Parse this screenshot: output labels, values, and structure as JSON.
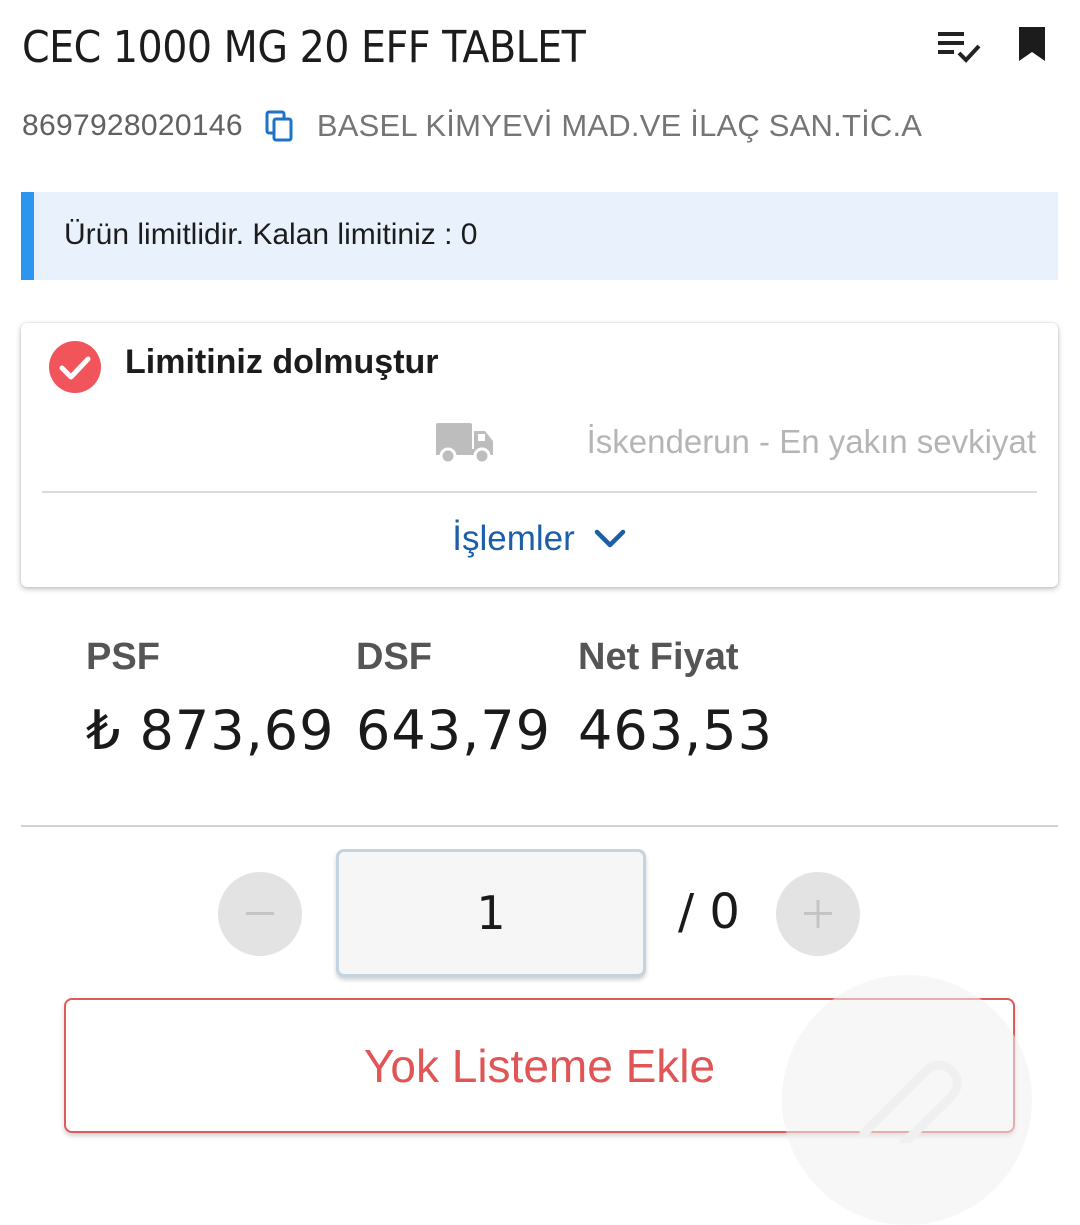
{
  "product": {
    "title": "CEC 1000 MG 20 EFF TABLET",
    "barcode": "8697928020146",
    "company": "BASEL KİMYEVİ MAD.VE İLAÇ SAN.TİC.A"
  },
  "icons": {
    "list": "playlist-check-icon",
    "bookmark": "bookmark-icon",
    "copy": "copy-icon",
    "status": "check-circle-icon",
    "truck": "truck-icon",
    "chevron": "chevron-down-icon",
    "minus": "minus-icon",
    "plus": "plus-icon"
  },
  "banner": {
    "text": "Ürün limitlidir. Kalan limitiniz : 0",
    "accent_color": "#2b95ef",
    "background_color": "#e9f2fc"
  },
  "status_card": {
    "status_text": "Limitiniz dolmuştur",
    "status_color": "#f2545b",
    "shipping_text": "İskenderun - En yakın sevkiyat",
    "actions_label": "İşlemler",
    "actions_color": "#1d5ea8"
  },
  "prices": {
    "psf": {
      "label": "PSF",
      "value": "₺ 873,69"
    },
    "dsf": {
      "label": "DSF",
      "value": "643,79"
    },
    "net": {
      "label": "Net Fiyat",
      "value": "463,53"
    }
  },
  "quantity": {
    "value": "1",
    "limit_text": "/ 0"
  },
  "add_button": {
    "label": "Yok Listeme Ekle",
    "color": "#e05656"
  }
}
